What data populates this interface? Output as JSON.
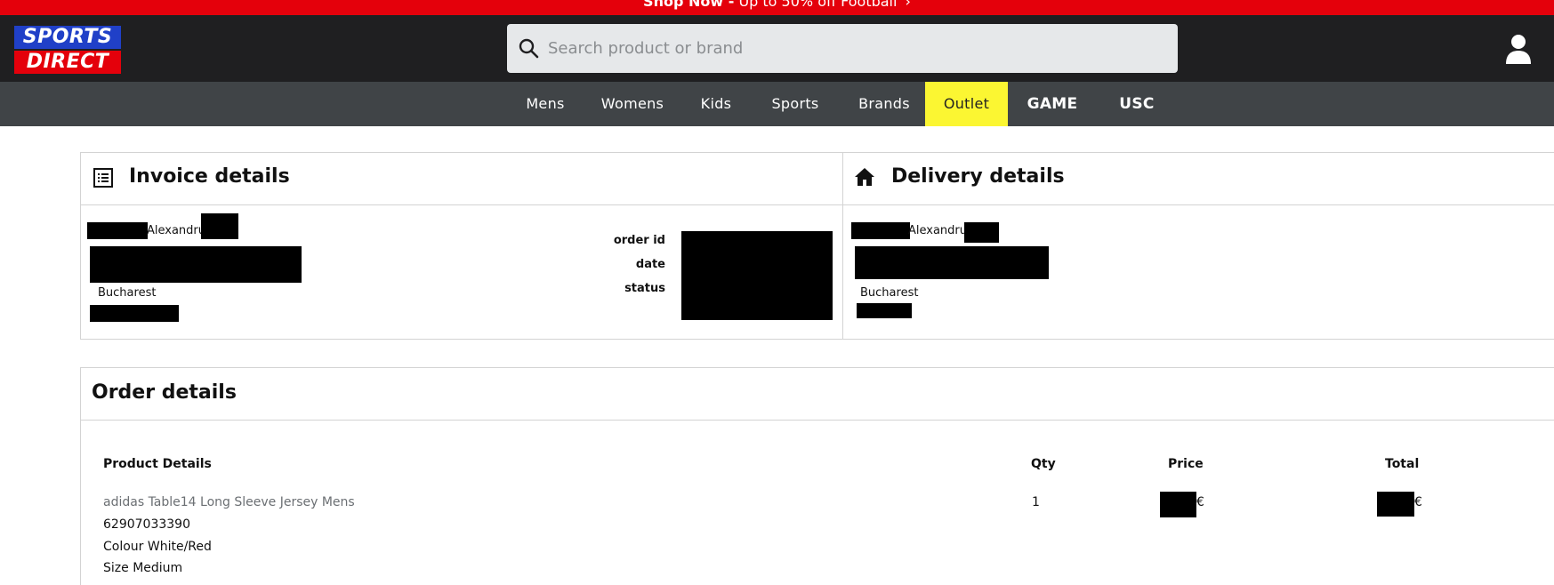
{
  "promo": {
    "strong": "Shop Now -",
    "rest": "Up to 50% off Football",
    "chevron": "›"
  },
  "brand": {
    "line1": "SPORTS",
    "line2": "DIRECT",
    "colors": {
      "top": "#2040c8",
      "bottom": "#e4000b"
    }
  },
  "search": {
    "placeholder": "Search product or brand",
    "value": "",
    "icon": "search-icon"
  },
  "account": {
    "icon": "user-icon"
  },
  "nav": {
    "items": [
      {
        "label": "Mens"
      },
      {
        "label": "Womens"
      },
      {
        "label": "Kids"
      },
      {
        "label": "Sports"
      },
      {
        "label": "Brands"
      },
      {
        "label": "Outlet",
        "highlight": "#fbf632"
      },
      {
        "label": "GAME"
      },
      {
        "label": "USC"
      }
    ]
  },
  "invoice": {
    "title": "Invoice details",
    "icon": "list-icon",
    "name_middle": "Alexandru",
    "city": "Bucharest",
    "labels": {
      "order_id": "order id",
      "date": "date",
      "status": "status"
    }
  },
  "delivery": {
    "title": "Delivery details",
    "icon": "home-icon",
    "name_middle": "Alexandru",
    "city": "Bucharest"
  },
  "order": {
    "title": "Order details",
    "headers": {
      "product": "Product Details",
      "qty": "Qty",
      "price": "Price",
      "total": "Total"
    },
    "items": [
      {
        "name": "adidas Table14 Long Sleeve Jersey Mens",
        "code": "62907033390",
        "colour": "Colour White/Red",
        "size": "Size Medium",
        "qty": "1",
        "price_currency": "€",
        "total_currency": "€"
      }
    ]
  }
}
